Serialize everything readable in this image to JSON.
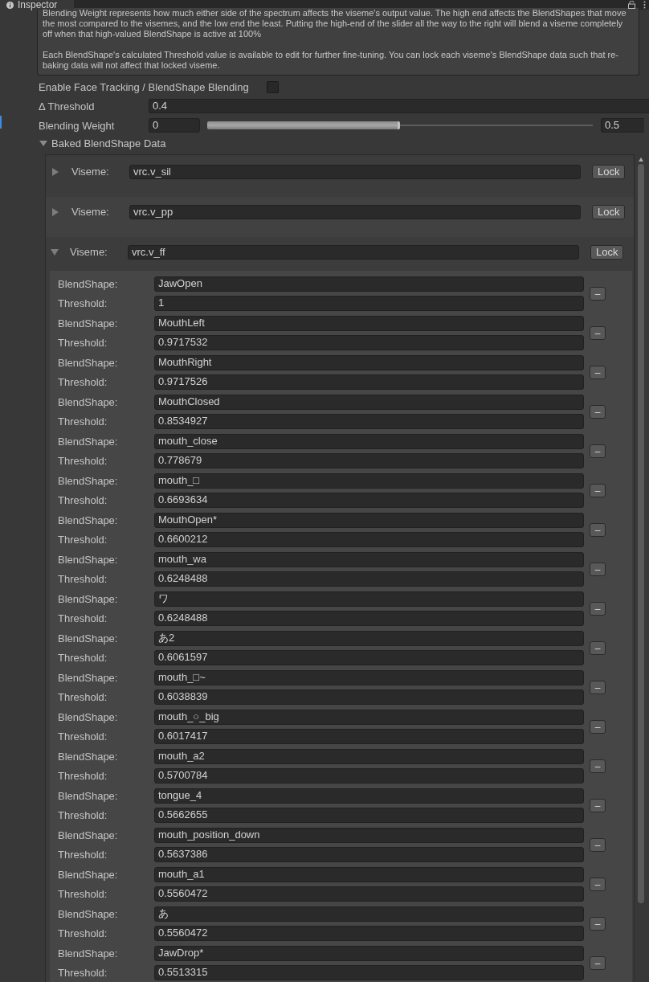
{
  "tab": {
    "title": "Inspector"
  },
  "help_text": [
    "Blending Weight represents how much either side of the spectrum affects the viseme's output value. The high end affects the BlendShapes that move the most compared to the visemes, and the low end the least. Putting the high-end of the slider all the way to the right will blend a viseme completely off when that high-valued BlendShape is active at 100%",
    "Each BlendShape's calculated Threshold value is available to edit for further fine-tuning. You can lock each viseme's BlendShape data such that re-baking data will not affect that locked viseme."
  ],
  "face_tracking": {
    "label": "Enable Face Tracking / BlendShape Blending",
    "checked": false
  },
  "threshold": {
    "label": "Δ Threshold",
    "value": "0.4"
  },
  "blending_weight": {
    "label": "Blending Weight",
    "min_value": "0",
    "max_value": "0.5",
    "level": 0.5
  },
  "baked": {
    "label": "Baked BlendShape Data",
    "expanded": true,
    "visemes": [
      {
        "label": "Viseme:",
        "value": "vrc.v_sil",
        "expanded": false,
        "button": "Lock"
      },
      {
        "label": "Viseme:",
        "value": "vrc.v_pp",
        "expanded": false,
        "button": "Lock"
      },
      {
        "label": "Viseme:",
        "value": "vrc.v_ff",
        "expanded": true,
        "button": "Lock",
        "blendshapes": [
          {
            "name_label": "BlendShape:",
            "name": "JawOpen",
            "threshold_label": "Threshold:",
            "threshold": "1",
            "button": "–"
          },
          {
            "name_label": "BlendShape:",
            "name": "MouthLeft",
            "threshold_label": "Threshold:",
            "threshold": "0.9717532",
            "button": "–"
          },
          {
            "name_label": "BlendShape:",
            "name": "MouthRight",
            "threshold_label": "Threshold:",
            "threshold": "0.9717526",
            "button": "–"
          },
          {
            "name_label": "BlendShape:",
            "name": "MouthClosed",
            "threshold_label": "Threshold:",
            "threshold": "0.8534927",
            "button": "–"
          },
          {
            "name_label": "BlendShape:",
            "name": "mouth_close",
            "threshold_label": "Threshold:",
            "threshold": "0.778679",
            "button": "–"
          },
          {
            "name_label": "BlendShape:",
            "name": "mouth_□",
            "threshold_label": "Threshold:",
            "threshold": "0.6693634",
            "button": "–"
          },
          {
            "name_label": "BlendShape:",
            "name": "MouthOpen*",
            "threshold_label": "Threshold:",
            "threshold": "0.6600212",
            "button": "–"
          },
          {
            "name_label": "BlendShape:",
            "name": "mouth_wa",
            "threshold_label": "Threshold:",
            "threshold": "0.6248488",
            "button": "–"
          },
          {
            "name_label": "BlendShape:",
            "name": "ワ",
            "threshold_label": "Threshold:",
            "threshold": "0.6248488",
            "button": "–"
          },
          {
            "name_label": "BlendShape:",
            "name": "あ2",
            "threshold_label": "Threshold:",
            "threshold": "0.6061597",
            "button": "–"
          },
          {
            "name_label": "BlendShape:",
            "name": "mouth_□~",
            "threshold_label": "Threshold:",
            "threshold": "0.6038839",
            "button": "–"
          },
          {
            "name_label": "BlendShape:",
            "name": "mouth_○_big",
            "threshold_label": "Threshold:",
            "threshold": "0.6017417",
            "button": "–"
          },
          {
            "name_label": "BlendShape:",
            "name": "mouth_a2",
            "threshold_label": "Threshold:",
            "threshold": "0.5700784",
            "button": "–"
          },
          {
            "name_label": "BlendShape:",
            "name": "tongue_4",
            "threshold_label": "Threshold:",
            "threshold": "0.5662655",
            "button": "–"
          },
          {
            "name_label": "BlendShape:",
            "name": "mouth_position_down",
            "threshold_label": "Threshold:",
            "threshold": "0.5637386",
            "button": "–"
          },
          {
            "name_label": "BlendShape:",
            "name": "mouth_a1",
            "threshold_label": "Threshold:",
            "threshold": "0.5560472",
            "button": "–"
          },
          {
            "name_label": "BlendShape:",
            "name": "あ",
            "threshold_label": "Threshold:",
            "threshold": "0.5560472",
            "button": "–"
          },
          {
            "name_label": "BlendShape:",
            "name": "JawDrop*",
            "threshold_label": "Threshold:",
            "threshold": "0.5513315",
            "button": "–"
          }
        ]
      }
    ]
  }
}
